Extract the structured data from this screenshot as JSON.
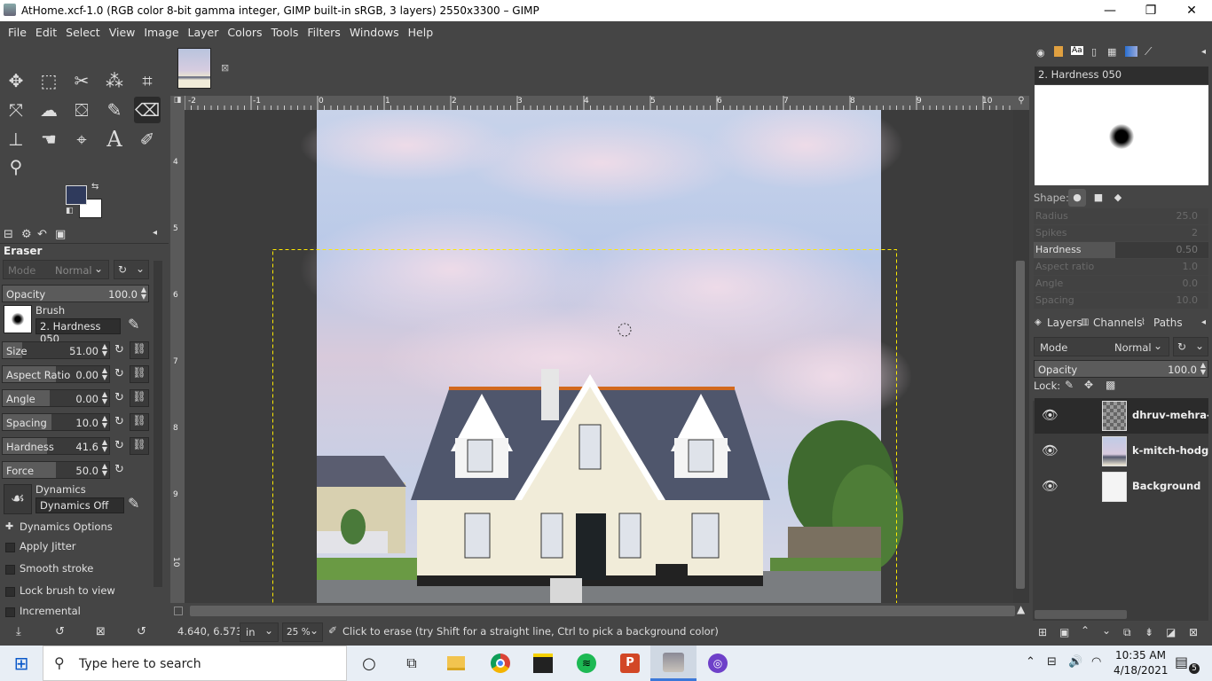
{
  "window": {
    "title": "AtHome.xcf-1.0 (RGB color 8-bit gamma integer, GIMP built-in sRGB, 3 layers) 2550x3300 – GIMP",
    "minimize": "—",
    "maximize": "❐",
    "close": "✕"
  },
  "menu": [
    "File",
    "Edit",
    "Select",
    "View",
    "Image",
    "Layer",
    "Colors",
    "Tools",
    "Filters",
    "Windows",
    "Help"
  ],
  "tool_options": {
    "title": "Eraser",
    "mode_label": "Mode",
    "mode_value": "Normal",
    "opacity_label": "Opacity",
    "opacity_value": "100.0",
    "brush_label": "Brush",
    "brush_value": "2. Hardness 050",
    "size_label": "Size",
    "size_value": "51.00",
    "aspect_label": "Aspect Ratio",
    "aspect_value": "0.00",
    "angle_label": "Angle",
    "angle_value": "0.00",
    "spacing_label": "Spacing",
    "spacing_value": "10.0",
    "hardness_label": "Hardness",
    "hardness_value": "41.6",
    "force_label": "Force",
    "force_value": "50.0",
    "dynamics_label": "Dynamics",
    "dynamics_value": "Dynamics Off",
    "dyn_options": "Dynamics Options",
    "apply_jitter": "Apply Jitter",
    "smooth_stroke": "Smooth stroke",
    "lock_brush": "Lock brush to view",
    "incremental": "Incremental"
  },
  "ruler": {
    "h_ticks": [
      "-2",
      "-1",
      "0",
      "1",
      "2",
      "3",
      "4",
      "5",
      "6",
      "7",
      "8",
      "9",
      "10"
    ],
    "v_ticks": [
      "4",
      "5",
      "6",
      "7",
      "8",
      "9",
      "10"
    ]
  },
  "status": {
    "coords": "4.640, 6.573",
    "unit": "in",
    "zoom": "25 %",
    "message": "Click to erase (try Shift for a straight line, Ctrl to pick a background color)"
  },
  "brushes": {
    "selected": "2. Hardness 050",
    "shape_label": "Shape:",
    "radius_label": "Radius",
    "radius_value": "25.0",
    "spikes_label": "Spikes",
    "spikes_value": "2",
    "hardness_label": "Hardness",
    "hardness_value": "0.50",
    "aspect_label": "Aspect ratio",
    "aspect_value": "1.0",
    "angle_label": "Angle",
    "angle_value": "0.0",
    "spacing_label": "Spacing",
    "spacing_value": "10.0"
  },
  "layers_panel": {
    "tabs": [
      "Layers",
      "Channels",
      "Paths"
    ],
    "mode_label": "Mode",
    "mode_value": "Normal",
    "opacity_label": "Opacity",
    "opacity_value": "100.0",
    "lock_label": "Lock:",
    "layers": [
      {
        "name": "dhruv-mehra-EItA"
      },
      {
        "name": "k-mitch-hodge-"
      },
      {
        "name": "Background"
      }
    ]
  },
  "taskbar": {
    "search_placeholder": "Type here to search",
    "time": "10:35 AM",
    "date": "4/18/2021",
    "notifications": "5"
  },
  "colors": {
    "fg": "#2f3a5c",
    "bg": "#ffffff",
    "accent": "#1e90ff"
  }
}
